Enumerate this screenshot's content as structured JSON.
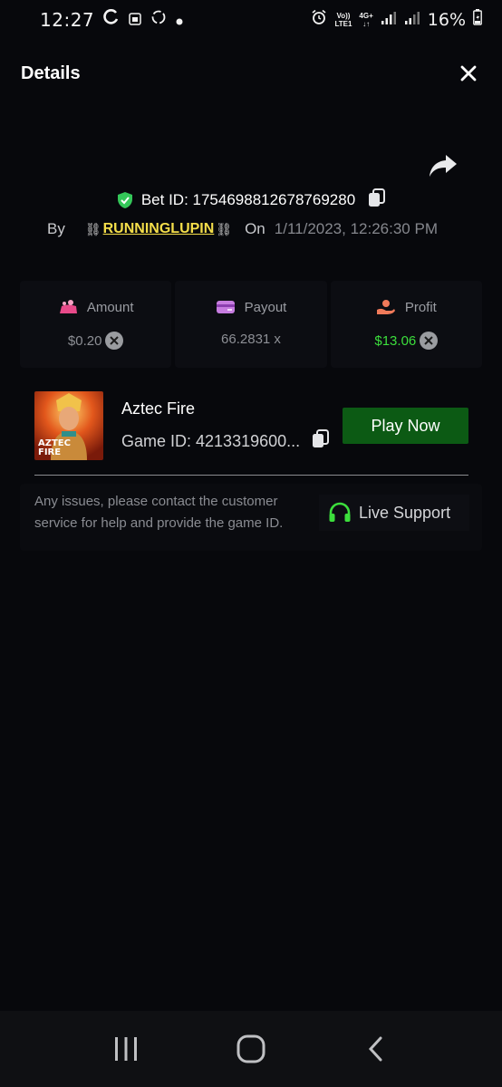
{
  "status_bar": {
    "time": "12:27",
    "network_top": "Vo))",
    "network_bottom": "LTE1",
    "data_type": "4G+",
    "battery": "16%"
  },
  "header": {
    "title": "Details"
  },
  "bet": {
    "bet_id": "Bet ID: 1754698812678769280",
    "by_label": "By",
    "username": "RUNNINGLUPIN",
    "on_label": "On",
    "timestamp": "1/11/2023, 12:26:30 PM"
  },
  "stats": {
    "amount_label": "Amount",
    "amount_value": "$0.20",
    "payout_label": "Payout",
    "payout_value": "66.2831 x",
    "profit_label": "Profit",
    "profit_value": "$13.06"
  },
  "game": {
    "name": "Aztec Fire",
    "game_id": "Game ID: 4213319600...",
    "thumb_text_1": "AZTEC",
    "thumb_text_2": "FIRE",
    "play_label": "Play Now"
  },
  "support": {
    "help_text": "Any issues, please contact the customer service for help and provide the game ID.",
    "live_support_label": "Live Support"
  },
  "colors": {
    "accent_green": "#3cde3c",
    "play_button": "#0c5a14",
    "username": "#f4de4a",
    "shield": "#34c759"
  }
}
